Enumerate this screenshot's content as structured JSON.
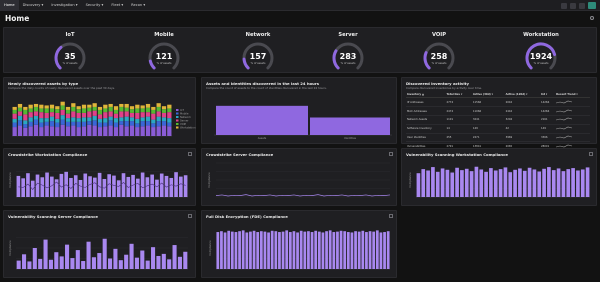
{
  "nav": {
    "items": [
      "Home",
      "Discovery ▾",
      "Investigation ▾",
      "Security ▾",
      "Fleet ▾",
      "Recon ▾"
    ]
  },
  "page": {
    "title": "Home"
  },
  "gauges": [
    {
      "label": "IoT",
      "value": "35",
      "sub": "% of assets",
      "fraction": 0.35
    },
    {
      "label": "Mobile",
      "value": "121",
      "sub": "% of assets",
      "fraction": 0.12
    },
    {
      "label": "Network",
      "value": "157",
      "sub": "% of assets",
      "fraction": 0.15
    },
    {
      "label": "Server",
      "value": "283",
      "sub": "% of assets",
      "fraction": 0.28
    },
    {
      "label": "VOIP",
      "value": "258",
      "sub": "% of assets",
      "fraction": 0.25
    },
    {
      "label": "Workstation",
      "value": "1924",
      "sub": "% of assets",
      "fraction": 0.78
    }
  ],
  "panels": {
    "newly_discovered": {
      "title": "Newly discovered assets by type",
      "subtitle": "Compare the daily counts of newly discovered assets over the past 30 days."
    },
    "assets_24h": {
      "title": "Assets and Identities discovered in the last 24 hours",
      "subtitle": "Compare the count of assets to the count of identities discovered in the last 24 hours."
    },
    "inventory": {
      "title": "Discovered inventory activity",
      "subtitle": "Compare discovered inventories by activity over time."
    },
    "crowdstrike_ws": {
      "title": "Crowdstrike Workstation Compliance"
    },
    "crowdstrike_server": {
      "title": "Crowdstrike Server Compliance"
    },
    "vuln_ws": {
      "title": "Vulnerability Scanning Workstation Compliance"
    },
    "vuln_server": {
      "title": "Vulnerability Scanning Server Compliance"
    },
    "fde": {
      "title": "Full Disk Encryption (FDE) Compliance"
    }
  },
  "inventory_table": {
    "headers": [
      "Inventory ▲",
      "Total Dev ▾",
      "Active (30d) ▾",
      "Active (120d) ▾",
      "Int ▾",
      "Recent Trend ▾"
    ],
    "rows": [
      [
        "IP Addresses",
        "2774",
        "11566",
        "2016",
        "14266",
        ""
      ],
      [
        "MAC Addresses",
        "2474",
        "11066",
        "2416",
        "14266",
        ""
      ],
      [
        "Network Assets",
        "1101",
        "3241",
        "3204",
        "2161",
        ""
      ],
      [
        "Software Inventory",
        "14",
        "149",
        "42",
        "149",
        ""
      ],
      [
        "User Identities",
        "255",
        "2471",
        "3969",
        "3366",
        ""
      ],
      [
        "Vulnerabilities",
        "2791",
        "13841",
        "2065",
        "28001",
        ""
      ]
    ]
  },
  "chart_data": [
    {
      "type": "bar",
      "title": "Newly discovered assets by type",
      "stacked": true,
      "categories": [
        "1",
        "2",
        "3",
        "4",
        "5",
        "6",
        "7",
        "8",
        "9",
        "10",
        "11",
        "12",
        "13",
        "14",
        "15",
        "16",
        "17",
        "18",
        "19",
        "20",
        "21",
        "22",
        "23",
        "24",
        "25",
        "26",
        "27",
        "28",
        "29",
        "30"
      ],
      "series": [
        {
          "name": "IoT",
          "color": "#8a5cd6",
          "values": [
            12,
            14,
            11,
            13,
            15,
            12,
            14,
            13,
            12,
            15,
            13,
            14,
            12,
            13,
            15,
            14,
            12,
            13,
            14,
            12,
            15,
            13,
            14,
            12,
            13,
            14,
            12,
            13,
            14,
            13
          ]
        },
        {
          "name": "Mobile",
          "color": "#3a66d6",
          "values": [
            6,
            7,
            5,
            6,
            7,
            6,
            5,
            7,
            6,
            7,
            6,
            5,
            7,
            6,
            5,
            7,
            6,
            5,
            7,
            6,
            5,
            7,
            6,
            5,
            7,
            6,
            5,
            7,
            6,
            5
          ]
        },
        {
          "name": "Network",
          "color": "#2ba7c2",
          "values": [
            5,
            6,
            5,
            6,
            5,
            6,
            5,
            6,
            5,
            6,
            5,
            6,
            5,
            6,
            5,
            6,
            5,
            6,
            5,
            6,
            5,
            6,
            5,
            6,
            5,
            6,
            5,
            6,
            5,
            6
          ]
        },
        {
          "name": "Server",
          "color": "#e0408a",
          "values": [
            7,
            6,
            8,
            7,
            6,
            8,
            7,
            6,
            8,
            7,
            6,
            8,
            7,
            6,
            8,
            7,
            6,
            8,
            7,
            6,
            8,
            7,
            6,
            8,
            7,
            6,
            8,
            7,
            6,
            8
          ]
        },
        {
          "name": "VOIP",
          "color": "#55b832",
          "values": [
            5,
            5,
            6,
            5,
            6,
            5,
            6,
            5,
            5,
            6,
            5,
            6,
            5,
            6,
            5,
            5,
            6,
            5,
            6,
            5,
            6,
            5,
            5,
            6,
            5,
            6,
            5,
            6,
            5,
            5
          ]
        },
        {
          "name": "Workstation",
          "color": "#e0b53a",
          "values": [
            4,
            5,
            4,
            5,
            4,
            5,
            4,
            5,
            4,
            5,
            4,
            5,
            4,
            5,
            4,
            5,
            4,
            5,
            4,
            5,
            4,
            5,
            4,
            5,
            4,
            5,
            4,
            5,
            4,
            5
          ]
        }
      ]
    },
    {
      "type": "bar",
      "title": "Assets and Identities discovered in the last 24 hours",
      "categories": [
        "Assets",
        "Identities"
      ],
      "values": [
        100,
        60
      ],
      "ylim": [
        0,
        120
      ]
    },
    {
      "type": "bar",
      "title": "Crowdstrike Workstation Compliance",
      "ylabel": "Compliance",
      "values": [
        62,
        55,
        70,
        48,
        66,
        58,
        72,
        60,
        52,
        68,
        74,
        56,
        64,
        50,
        69,
        61,
        57,
        71,
        53,
        67,
        63,
        49,
        70,
        59,
        65,
        54,
        72,
        58,
        66,
        51,
        69,
        62,
        56,
        73,
        60,
        64
      ],
      "line": [
        30,
        28,
        38,
        22,
        41,
        35,
        27,
        33,
        44,
        29,
        36,
        25,
        40,
        32,
        28,
        37,
        42,
        30,
        26,
        39,
        34,
        31,
        43,
        28,
        35,
        40,
        27,
        33,
        38,
        30,
        41,
        29,
        36,
        32,
        39,
        34
      ],
      "ylim": [
        0,
        100
      ]
    },
    {
      "type": "line",
      "title": "Crowdstrike Server Compliance",
      "ylabel": "Compliance",
      "values": [
        4,
        6,
        3,
        5,
        4,
        7,
        3,
        5,
        4,
        6,
        3,
        5,
        4,
        6,
        3,
        5,
        4,
        7,
        3,
        5,
        4,
        6,
        3,
        5,
        4,
        6,
        3,
        5,
        4,
        6
      ],
      "ylim": [
        0,
        100
      ]
    },
    {
      "type": "bar",
      "title": "Vulnerability Scanning Workstation Compliance",
      "ylabel": "Compliance",
      "values": [
        70,
        82,
        78,
        88,
        74,
        84,
        80,
        72,
        86,
        79,
        83,
        76,
        89,
        81,
        74,
        85,
        78,
        82,
        87,
        73,
        80,
        84,
        77,
        86,
        81,
        75,
        83,
        88,
        79,
        84,
        76,
        82,
        85,
        78,
        81,
        87
      ],
      "ylim": [
        0,
        100
      ]
    },
    {
      "type": "bar",
      "title": "Vulnerability Scanning Server Compliance",
      "ylabel": "Compliance",
      "values": [
        20,
        35,
        18,
        50,
        24,
        70,
        22,
        40,
        30,
        58,
        26,
        45,
        19,
        65,
        28,
        38,
        72,
        25,
        48,
        21,
        34,
        60,
        27,
        44,
        20,
        52,
        31,
        36,
        23,
        57,
        29,
        41
      ],
      "ylim": [
        0,
        100
      ]
    },
    {
      "type": "bar",
      "title": "Full Disk Encryption (FDE) Compliance",
      "ylabel": "Compliance",
      "values": [
        88,
        90,
        87,
        91,
        89,
        88,
        90,
        92,
        87,
        89,
        91,
        88,
        90,
        89,
        87,
        91,
        90,
        88,
        89,
        92,
        88,
        90,
        87,
        91,
        89,
        90,
        88,
        91,
        89,
        87,
        90,
        92,
        88,
        89,
        91,
        90,
        88,
        87,
        90,
        89,
        91,
        88,
        90,
        89,
        92,
        87,
        88,
        90
      ],
      "ylim": [
        0,
        100
      ]
    }
  ]
}
